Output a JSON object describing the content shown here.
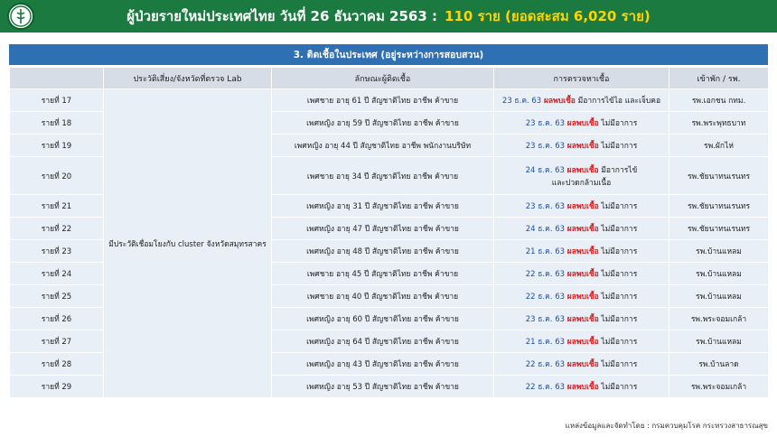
{
  "header": {
    "title_main": "ผู้ป่วยรายใหม่ประเทศไทย วันที่ 26 ธันวาคม 2563  :",
    "title_highlight": "110 ราย (ยอดสะสม 6,020 ราย)"
  },
  "section_title": "3. ติดเชื้อในประเทศ  (อยู่ระหว่างการสอบสวน)",
  "columns": [
    "",
    "ประวัติเสี่ยง/จังหวัดที่ตรวจ  Lab",
    "ลักษณะผู้ติดเชื้อ",
    "การตรวจหาเชื้อ",
    "เข้าพัก / รพ."
  ],
  "risk": "มีประวัติเชื่อมโยงกับ cluster จังหวัดสมุทรสาคร",
  "positive_label": "ผลพบเชื้อ",
  "rows": [
    {
      "case": "รายที่ 17",
      "profile": "เพศชาย อายุ 61 ปี สัญชาติไทย อาชีพ ค้าขาย",
      "date": "23 ธ.ค. 63",
      "symptom": "มีอาการไข้ไอ และเจ็บคอ",
      "hospital": "รพ.เอกชน กทม."
    },
    {
      "case": "รายที่ 18",
      "profile": "เพศหญิง อายุ 59 ปี สัญชาติไทย อาชีพ ค้าขาย",
      "date": "23 ธ.ค. 63",
      "symptom": "ไม่มีอาการ",
      "hospital": "รพ.พระพุทธบาท"
    },
    {
      "case": "รายที่ 19",
      "profile": "เพศหญิง อายุ 44 ปี สัญชาติไทย อาชีพ พนักงานบริษัท",
      "date": "23 ธ.ค. 63",
      "symptom": "ไม่มีอาการ",
      "hospital": "รพ.ผักไห่"
    },
    {
      "case": "รายที่ 20",
      "profile": "เพศชาย อายุ 34 ปี สัญชาติไทย อาชีพ ค้าขาย",
      "date": "24 ธ.ค. 63",
      "symptom": "มีอาการไข้",
      "symptom2": "และปวดกล้ามเนื้อ",
      "hospital": "รพ.ชัยนาทนเรนทร"
    },
    {
      "case": "รายที่ 21",
      "profile": "เพศหญิง อายุ 31 ปี สัญชาติไทย อาชีพ ค้าขาย",
      "date": "23 ธ.ค. 63",
      "symptom": "ไม่มีอาการ",
      "hospital": "รพ.ชัยนาทนเรนทร"
    },
    {
      "case": "รายที่  22",
      "profile": "เพศหญิง อายุ 47 ปี สัญชาติไทย อาชีพ ค้าขาย",
      "date": "24 ธ.ค. 63",
      "symptom": "ไม่มีอาการ",
      "hospital": "รพ.ชัยนาทนเรนทร"
    },
    {
      "case": "รายที่  23",
      "profile": "เพศหญิง อายุ 48 ปี สัญชาติไทย อาชีพ ค้าขาย",
      "date": "21 ธ.ค. 63",
      "symptom": "ไม่มีอาการ",
      "hospital": "รพ.บ้านแหลม"
    },
    {
      "case": "รายที่ 24",
      "profile": "เพศชาย อายุ 45 ปี สัญชาติไทย อาชีพ ค้าขาย",
      "date": "22 ธ.ค. 63",
      "symptom": "ไม่มีอาการ",
      "hospital": "รพ.บ้านแหลม"
    },
    {
      "case": "รายที่ 25",
      "profile": "เพศชาย อายุ 40 ปี สัญชาติไทย อาชีพ ค้าขาย",
      "date": "22 ธ.ค. 63",
      "symptom": "ไม่มีอาการ",
      "hospital": "รพ.บ้านแหลม"
    },
    {
      "case": "รายที่ 26",
      "profile": "เพศหญิง อายุ 60 ปี สัญชาติไทย อาชีพ ค้าขาย",
      "date": "23 ธ.ค. 63",
      "symptom": "ไม่มีอาการ",
      "hospital": "รพ.พระจอมเกล้า"
    },
    {
      "case": "รายที่ 27",
      "profile": "เพศหญิง อายุ 64 ปี สัญชาติไทย อาชีพ ค้าขาย",
      "date": "21  ธ.ค. 63",
      "symptom": "ไม่มีอาการ",
      "hospital": "รพ.บ้านแหลม"
    },
    {
      "case": "รายที่ 28",
      "profile": "เพศหญิง อายุ 43 ปี สัญชาติไทย อาชีพ ค้าขาย",
      "date": "22  ธ.ค. 63",
      "symptom": "ไม่มีอาการ",
      "hospital": "รพ.บ้านลาด"
    },
    {
      "case": "รายที่ 29",
      "profile": "เพศหญิง อายุ 53 ปี สัญชาติไทย อาชีพ ค้าขาย",
      "date": "22 ธ.ค. 63",
      "symptom": "ไม่มีอาการ",
      "hospital": "รพ.พระจอมเกล้า"
    }
  ],
  "footer": "แหล่งข้อมูลและจัดทำโดย : กรมควบคุมโรค กระทรวงสาธารณสุข",
  "colors": {
    "header_bg": "#1b7a40",
    "banner_bg": "#2f6fb3",
    "highlight": "#ffd400",
    "positive": "#d21f1f",
    "date": "#1f4fa0"
  }
}
